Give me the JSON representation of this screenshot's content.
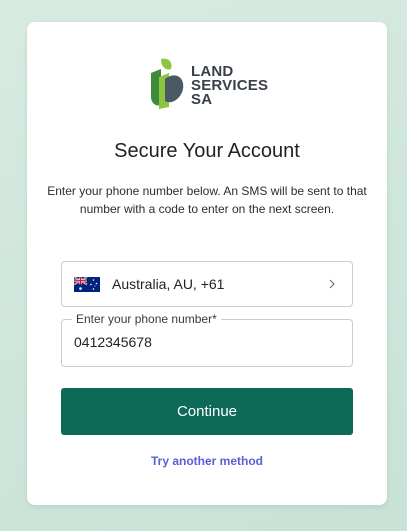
{
  "logo": {
    "line1": "LAND",
    "line2": "SERVICES",
    "line3": "SA",
    "colors": {
      "green_dark": "#3e8a3c",
      "green_light": "#8cc63f",
      "slate": "#4a5a63"
    }
  },
  "title": "Secure Your Account",
  "description": "Enter your phone number below. An SMS will be sent to that number with a code to enter on the next screen.",
  "country_selector": {
    "label": "Australia, AU, +61",
    "flag_icon": "australia-flag-icon",
    "chevron_icon": "chevron-right-icon"
  },
  "phone_field": {
    "label": "Enter your phone number*",
    "value": "0412345678"
  },
  "continue_label": "Continue",
  "alt_method_label": "Try another method",
  "colors": {
    "primary": "#0d6a57",
    "link": "#5b5fd6",
    "background": "#d7ebe1"
  }
}
